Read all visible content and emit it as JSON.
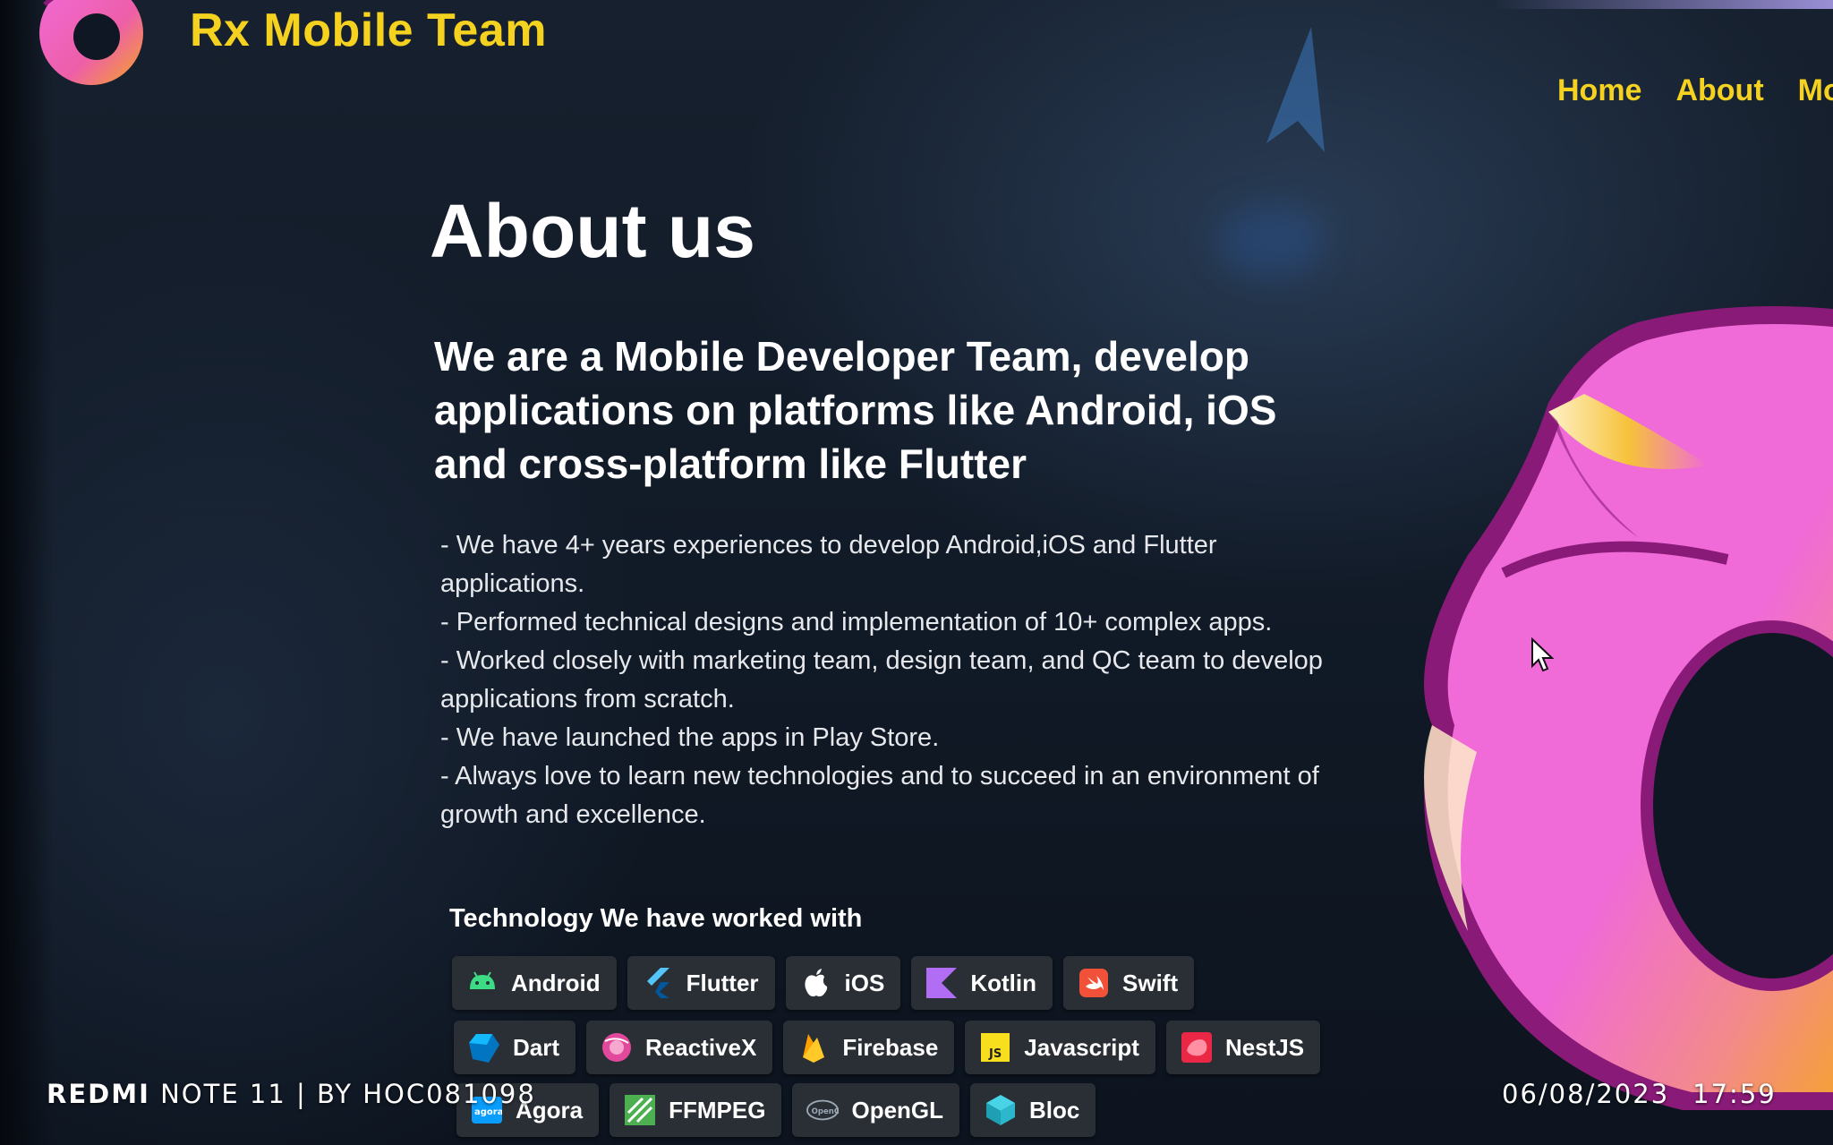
{
  "header": {
    "brand": "Rx Mobile Team",
    "nav": [
      {
        "label": "Home"
      },
      {
        "label": "About"
      },
      {
        "label": "Mo"
      }
    ]
  },
  "main": {
    "title": "About us",
    "headline": "We are a Mobile Developer Team, develop applications on platforms like Android, iOS and cross-platform like Flutter",
    "bullets": [
      "- We have 4+ years experiences to develop Android,iOS and Flutter applications.",
      "- Performed technical designs and implementation of 10+ complex apps.",
      "- Worked closely with marketing team, design team, and QC team to develop applications from scratch.",
      "- We have launched the apps in Play Store.",
      "- Always love to learn new technologies and to succeed in an environment of growth and excellence."
    ],
    "tech_title": "Technology We have worked with",
    "technologies": [
      {
        "label": "Android",
        "icon": "android-icon"
      },
      {
        "label": "Flutter",
        "icon": "flutter-icon"
      },
      {
        "label": "iOS",
        "icon": "apple-icon"
      },
      {
        "label": "Kotlin",
        "icon": "kotlin-icon"
      },
      {
        "label": "Swift",
        "icon": "swift-icon"
      },
      {
        "label": "Dart",
        "icon": "dart-icon"
      },
      {
        "label": "ReactiveX",
        "icon": "reactivex-icon"
      },
      {
        "label": "Firebase",
        "icon": "firebase-icon"
      },
      {
        "label": "Javascript",
        "icon": "javascript-icon"
      },
      {
        "label": "NestJS",
        "icon": "nestjs-icon"
      },
      {
        "label": "Agora",
        "icon": "agora-icon"
      },
      {
        "label": "FFMPEG",
        "icon": "ffmpeg-icon"
      },
      {
        "label": "OpenGL",
        "icon": "opengl-icon"
      },
      {
        "label": "Bloc",
        "icon": "bloc-icon"
      }
    ]
  },
  "overlay": {
    "device_bold": "REDMI",
    "device_rest": " NOTE 11 | BY HOC081098",
    "date": "06/08/2023",
    "time": "17:59"
  },
  "colors": {
    "accent_yellow": "#f4d21f",
    "background": "#0f1724",
    "chip_background": "#2a2f36",
    "mascot_pink": "#f06ad8",
    "mascot_orange": "#f5a623"
  }
}
